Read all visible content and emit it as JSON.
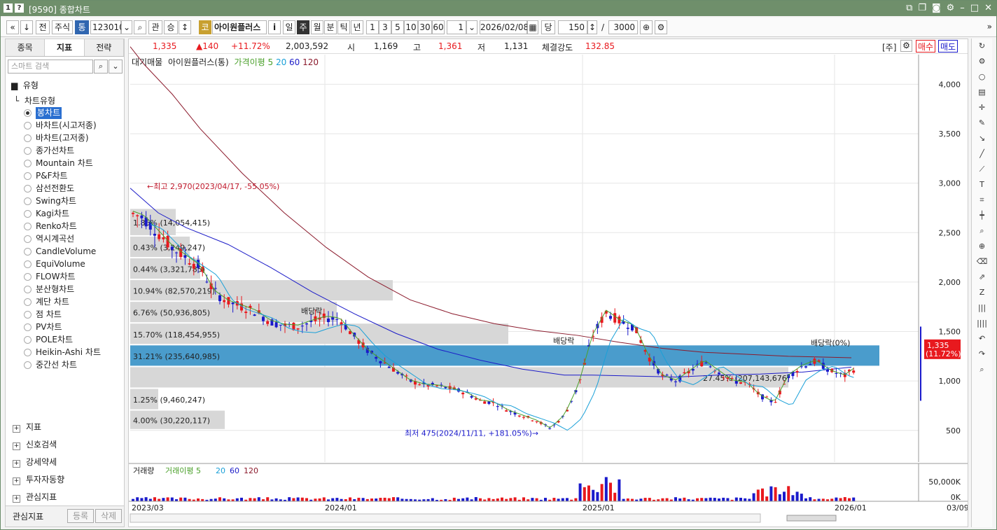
{
  "window": {
    "title": "[9590] 종합차트",
    "badge": "1",
    "help": "?"
  },
  "toolbar": {
    "nav_prev": "«",
    "nav_next": "»",
    "down": "↓",
    "jeon": "전",
    "market": "주식",
    "tong": "통",
    "code": "123010",
    "search_icon": "⌕",
    "gwan": "관",
    "seung": "승",
    "updown": "↕",
    "kodak": "코",
    "name": "아이원플러스",
    "info": "i",
    "periods": [
      "일",
      "주",
      "월",
      "분",
      "틱",
      "년"
    ],
    "active_period": "주",
    "nums": [
      "1",
      "3",
      "5",
      "10",
      "30",
      "60"
    ],
    "count": "1",
    "date": "2026/02/08",
    "dang": "당",
    "bars": "150",
    "slash": "/",
    "total": "3000"
  },
  "left": {
    "tabs": [
      "종목",
      "지표",
      "전략"
    ],
    "active_tab": "지표",
    "search_placeholder": "스마트 검색",
    "section_type": "유형",
    "tree_root": "차트유형",
    "chart_types": [
      "봉차트",
      "바차트(시고저종)",
      "바차트(고저종)",
      "종가선차트",
      "Mountain 차트",
      "P&F차트",
      "삼선전환도",
      "Swing차트",
      "Kagi차트",
      "Renko차트",
      "역시계곡선",
      "CandleVolume",
      "EquiVolume",
      "FLOW차트",
      "분산형차트",
      "계단 차트",
      "점 차트",
      "PV차트",
      "POLE차트",
      "Heikin-Ashi 차트",
      "중간선 차트"
    ],
    "selected": "봉차트",
    "sections": [
      "지표",
      "신호검색",
      "강세약세",
      "투자자동향",
      "관심지표"
    ],
    "footer_label": "관심지표",
    "register": "등록",
    "delete": "삭제"
  },
  "info": {
    "price": "1,335",
    "change": "▲140",
    "pct": "+11.72%",
    "volume": "2,003,592",
    "open_lbl": "시",
    "open": "1,169",
    "high_lbl": "고",
    "high": "1,361",
    "low_lbl": "저",
    "low": "1,131",
    "strength_lbl": "체결강도",
    "strength": "132.85",
    "ju": "[주]",
    "buy": "매수",
    "sell": "매도"
  },
  "legend": {
    "price": "대기매물",
    "name": "아이원플러스(통)",
    "ma_lbl": "가격이평 5",
    "ma20": "20",
    "ma60": "60",
    "ma120": "120"
  },
  "vol_legend": {
    "lbl": "거래량",
    "ma_lbl": "거래이평 5",
    "ma20": "20",
    "ma60": "60",
    "ma120": "120"
  },
  "colors": {
    "up": "#e8191e",
    "down": "#1a1acb",
    "ma5": "#4aa02a",
    "ma20": "#1aa0d8",
    "ma60": "#1c1cc8",
    "ma120": "#8b1a2c",
    "band": "#4a9ccc",
    "gray": "#d7d7d7"
  },
  "chart_data": {
    "type": "candlestick",
    "yaxis_ticks": [
      "4,000",
      "3,500",
      "3,000",
      "2,500",
      "2,000",
      "1,500",
      "1,000",
      "500"
    ],
    "y_tick_values": [
      4000,
      3500,
      3000,
      2500,
      2000,
      1500,
      1000,
      500
    ],
    "ylim": [
      180,
      4300
    ],
    "xaxis_ticks": [
      "2023/03",
      "2024/01",
      "2025/01",
      "2026/01"
    ],
    "x_right": "03/09",
    "vol_ticks": [
      "50,000K",
      "0K"
    ],
    "current": {
      "price": "1,335",
      "pct": "(11.72%)",
      "value": 1335
    },
    "annotations": {
      "high": "←최고 2,970(2023/04/17, -55.05%)",
      "low": "최저 475(2024/11/11, +181.05%)→",
      "div1": "배당락",
      "div2": "배당락",
      "div3": "배당락(0%)"
    },
    "volume_profile": [
      {
        "label": "4.00% (30,220,117)",
        "lo": 500,
        "hi": 700,
        "w": 135
      },
      {
        "label": "1.25% (9,460,247)",
        "lo": 700,
        "hi": 920,
        "w": 40
      },
      {
        "label": "",
        "lo": 920,
        "hi": 1140,
        "w": 940
      },
      {
        "label": "31.21% (235,640,985)",
        "lo": 1140,
        "hi": 1360,
        "w": 1070,
        "hl": true
      },
      {
        "label": "15.70% (118,454,955)",
        "lo": 1360,
        "hi": 1580,
        "w": 540
      },
      {
        "label": "6.76% (50,936,805)",
        "lo": 1580,
        "hi": 1800,
        "w": 295
      },
      {
        "label": "10.94% (82,570,219)",
        "lo": 1800,
        "hi": 2020,
        "w": 375
      },
      {
        "label": "0.44% (3,321,785)",
        "lo": 2020,
        "hi": 2240,
        "w": 100
      },
      {
        "label": "0.43% (3,249,247)",
        "lo": 2240,
        "hi": 2460,
        "w": 85
      },
      {
        "label": "1.86% (14,054,415)",
        "lo": 2460,
        "hi": 2740,
        "w": 65
      }
    ],
    "vp_label_27": "27.45% (207,143,676)",
    "ma120": [
      [
        0,
        4380
      ],
      [
        20,
        4200
      ],
      [
        60,
        3900
      ],
      [
        100,
        3550
      ],
      [
        160,
        3100
      ],
      [
        220,
        2700
      ],
      [
        280,
        2350
      ],
      [
        340,
        2050
      ],
      [
        400,
        1820
      ],
      [
        460,
        1680
      ],
      [
        520,
        1580
      ],
      [
        580,
        1510
      ],
      [
        640,
        1460
      ],
      [
        700,
        1390
      ],
      [
        760,
        1330
      ],
      [
        820,
        1290
      ],
      [
        880,
        1270
      ],
      [
        940,
        1250
      ],
      [
        1000,
        1240
      ],
      [
        1030,
        1235
      ]
    ],
    "ma60": [
      [
        0,
        2950
      ],
      [
        40,
        2700
      ],
      [
        80,
        2550
      ],
      [
        140,
        2380
      ],
      [
        200,
        2150
      ],
      [
        260,
        1900
      ],
      [
        320,
        1680
      ],
      [
        380,
        1480
      ],
      [
        440,
        1320
      ],
      [
        500,
        1210
      ],
      [
        560,
        1120
      ],
      [
        620,
        1060
      ],
      [
        660,
        1060
      ],
      [
        720,
        1050
      ],
      [
        780,
        1040
      ],
      [
        840,
        1060
      ],
      [
        900,
        1070
      ],
      [
        960,
        1090
      ],
      [
        1030,
        1140
      ]
    ]
  }
}
